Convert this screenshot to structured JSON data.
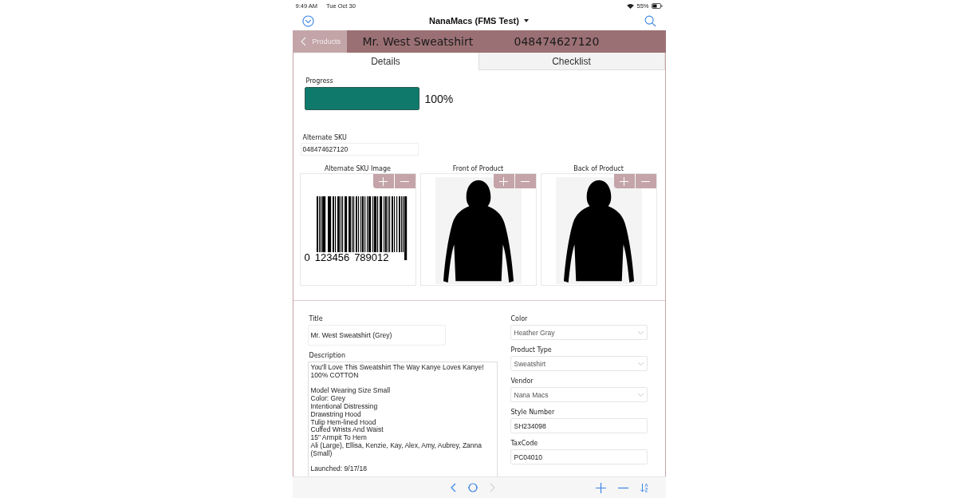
{
  "status_bar": {
    "time": "9:49 AM",
    "date": "Tue Oct 30",
    "battery": "55%"
  },
  "nav": {
    "title": "NanaMacs (FMS Test)"
  },
  "header": {
    "back": "Products",
    "title": "Mr. West Sweatshirt",
    "code": "048474627120"
  },
  "tabs": [
    {
      "label": "Details",
      "selected": true
    },
    {
      "label": "Checklist",
      "selected": false
    }
  ],
  "progress": {
    "label": "Progress",
    "level": 1,
    "reading": "100%"
  },
  "alternate_sku": {
    "label": "Alternate SKU",
    "value": "048474627120"
  },
  "images": [
    {
      "kind": "barcode",
      "label": "Alternate SKU Image",
      "digits": [
        "0",
        "123456",
        "789012"
      ]
    },
    {
      "kind": "hoodie",
      "label": "Front of Product"
    },
    {
      "kind": "hoodie",
      "label": "Back of Product"
    }
  ],
  "fields_left": [
    {
      "kind": "text",
      "label": "Title",
      "value": "Mr. West Sweatshirt (Grey)"
    },
    {
      "kind": "textarea",
      "label": "Description",
      "value": "You'll Love This Sweatshirt The Way Kanye Loves Kanye!\n100% COTTON\n\nModel Wearing Size Small\nColor: Grey\nIntentional Distressing\nDrawstring Hood\nTulip Hem-lined Hood\nCuffed Wrists And Waist\n15\" Armpit To Hem\nAli (Large), Ellisa, Kenzie, Kay, Alex, Amy, Aubrey, Zanna (Small)\n\nLaunched: 9/17/18"
    }
  ],
  "fields_right": [
    {
      "kind": "select",
      "label": "Color",
      "value": "Heather Gray"
    },
    {
      "kind": "select",
      "label": "Product Type",
      "value": "Sweatshirt"
    },
    {
      "kind": "select",
      "label": "Vendor",
      "value": "Nana Macs"
    },
    {
      "kind": "text",
      "label": "Style Number",
      "value": "SH234098"
    },
    {
      "kind": "text",
      "label": "TaxCode",
      "value": "PC04010"
    }
  ],
  "toolbar": [
    {
      "kind": "back",
      "disabled": false
    },
    {
      "kind": "home",
      "disabled": false
    },
    {
      "kind": "forward",
      "disabled": true
    },
    {
      "kind": "add",
      "disabled": false
    },
    {
      "kind": "remove",
      "disabled": false
    },
    {
      "kind": "sort",
      "disabled": false
    }
  ]
}
